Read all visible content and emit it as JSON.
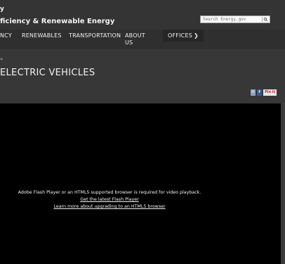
{
  "header": {
    "logo_fragment": "y",
    "office_name": "ficiency & Renewable Energy",
    "search_placeholder": "Search Energy.gov"
  },
  "nav": {
    "items": [
      {
        "label": "NCY"
      },
      {
        "label": "RENEWABLES"
      },
      {
        "label": "TRANSPORTATION"
      },
      {
        "label": "ABOUT US"
      },
      {
        "label": "OFFICES"
      }
    ]
  },
  "breadcrumb": "»",
  "page_title": "ELECTRIC VEHICLES",
  "share": {
    "email": "✉",
    "facebook": "f",
    "pinterest": "Pin it"
  },
  "player": {
    "message": "Adobe Flash Player or an HTML5 supported browser is required for video playback.",
    "flash_link": "Get the latest Flash Player",
    "html5_link": "Learn more about upgrading to an HTML5 browser"
  },
  "colors": {
    "background": "#373737",
    "nav": "#2f2f2f",
    "player": "#000000"
  }
}
